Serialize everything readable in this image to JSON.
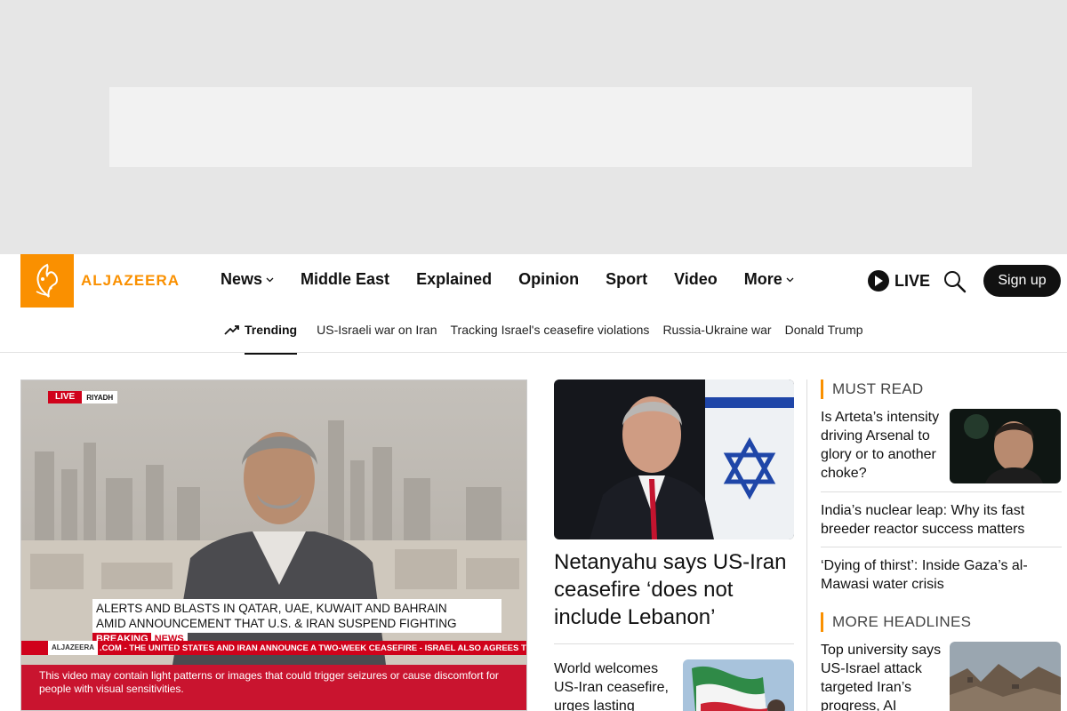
{
  "brand": {
    "name": "ALJAZEERA",
    "accent": "#fa9000"
  },
  "nav": {
    "items": [
      {
        "label": "News",
        "dropdown": true
      },
      {
        "label": "Middle East",
        "dropdown": false
      },
      {
        "label": "Explained",
        "dropdown": false
      },
      {
        "label": "Opinion",
        "dropdown": false
      },
      {
        "label": "Sport",
        "dropdown": false
      },
      {
        "label": "Video",
        "dropdown": false
      },
      {
        "label": "More",
        "dropdown": true
      }
    ],
    "live_label": "LIVE",
    "signup_label": "Sign up",
    "search_icon": "search-icon"
  },
  "trending": {
    "label": "Trending",
    "links": [
      "US-Israeli war on Iran",
      "Tracking Israel's ceasefire violations",
      "Russia-Ukraine war",
      "Donald Trump"
    ]
  },
  "video": {
    "live_badge": "LIVE",
    "location": "RIYADH",
    "headline_line1": "ALERTS AND BLASTS IN QATAR, UAE, KUWAIT AND BAHRAIN",
    "headline_line2": "AMID ANNOUNCEMENT THAT U.S. & IRAN SUSPEND FIGHTING",
    "breaking_1": "BREAKING",
    "breaking_2": "NEWS",
    "ticker_logo": "ALJAZEERA",
    "ticker_text": ".COM  -  THE UNITED STATES AND IRAN ANNOUNCE A TWO-WEEK CEASEFIRE  -  ISRAEL ALSO AGREES TO",
    "warning": "This video may contain light patterns or images that could trigger seizures or cause discomfort for people with visual sensitivities."
  },
  "center": {
    "main_title": "Netanyahu says US-Iran ceasefire ‘does not include Lebanon’",
    "secondary_title": "World welcomes US-Iran ceasefire, urges lasting"
  },
  "sidebar": {
    "must_read_label": "MUST READ",
    "must_read": [
      "Is Arteta’s intensity driving Arsenal to glory or to another choke?",
      "India’s nuclear leap: Why its fast breeder reactor success matters",
      "‘Dying of thirst’: Inside Gaza’s al-Mawasi water crisis"
    ],
    "more_headlines_label": "MORE HEADLINES",
    "more_headlines": [
      "Top university says US-Israel attack targeted Iran’s progress, AI"
    ]
  }
}
